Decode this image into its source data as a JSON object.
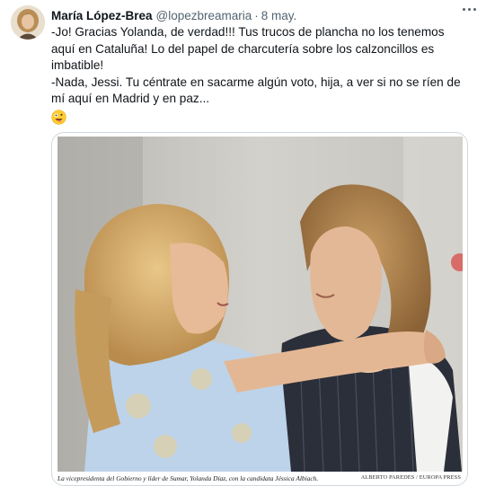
{
  "tweet": {
    "author_name": "María López-Brea",
    "handle": "@lopezbreamaria",
    "separator": "·",
    "date": "8 may.",
    "lines": [
      "-Jo! Gracias Yolanda, de verdad!!! Tus trucos de plancha no los tenemos",
      "aquí en Cataluña! Lo del papel de charcutería sobre los calzoncillos es",
      "imbatible!",
      "-Nada, Jessi. Tu céntrate en sacarme algún voto, hija, a ver si no se ríen de",
      "mí aquí en Madrid y en paz..."
    ],
    "emoji": "zany-face-emoji"
  },
  "media": {
    "caption": "La vicepresidenta del Gobierno y líder de Sumar, Yolanda Díaz, con la candidata Jéssica Albiach.",
    "credit": "ALBERTO PAREDES / EUROPA PRESS"
  },
  "icons": {
    "more": "more-horizontal-icon"
  },
  "colors": {
    "text_primary": "#0f1419",
    "text_secondary": "#536471",
    "border": "#cfd9de"
  }
}
